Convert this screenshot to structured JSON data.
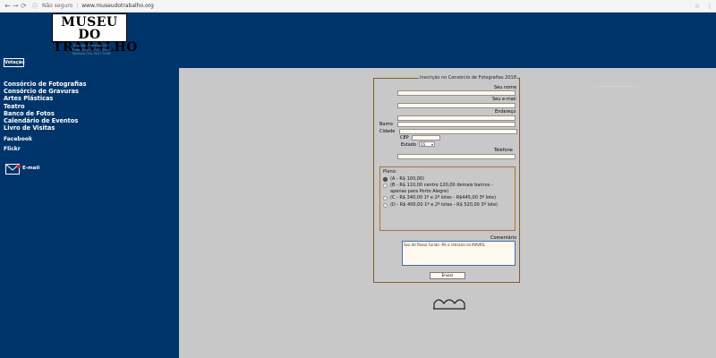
{
  "browser": {
    "security_label": "Não seguro",
    "url": "www.museudotrabalho.org"
  },
  "header": {
    "logo_line1": "MUSEU DO",
    "logo_line2": "TRABALHO",
    "address_lines": [
      "Rua das Andradas 230",
      "Porto Alegre - RS - Brasil",
      "Telefone (51) 3227 5196"
    ]
  },
  "sidebar": {
    "votacao_label": "Votação",
    "menu": [
      "Consórcio de Fotografias",
      "Consórcio de Gravuras",
      "Artes Plásticas",
      "Teatro",
      "Banco de Fotos",
      "Calendário de Eventos",
      "Livro de Visitas"
    ],
    "facebook_label": "Facebook",
    "flickr_label": "Flickr",
    "email_label": "E-mail"
  },
  "form": {
    "legend": "Inscrição no Consórcio de Fotografias 2018",
    "nome_label": "Seu nome",
    "email_label": "Seu e-mail",
    "endereco_label": "Endereço",
    "bairro_label": "Bairro",
    "cidade_label": "Cidade",
    "cep_label": "CEP",
    "estado_label": "Estado",
    "estado_value": "RS",
    "telefone_label": "Telefone",
    "plano_label": "Plano:",
    "options": [
      "(A - R$ 100,00)",
      "(B - R$ 110,00 centro 120,00 demais bairros - apenas para Porto Alegre)",
      "(C - R$ 340,00 1º e 2º lotes - R$445,00 3º lote)",
      "(D - R$ 400,00 1º e 2º lotes - R$ 520,00 3º lote)"
    ],
    "selected_option": 0,
    "comentario_label": "Comentário",
    "comentario_value": "Sou de Passo Fundo -RS e retirarei no MAVRS.",
    "submit_label": "Enviar"
  },
  "colors": {
    "navy": "#00356b",
    "field_bg": "#fff8ee",
    "form_border": "#8a5a2b"
  }
}
